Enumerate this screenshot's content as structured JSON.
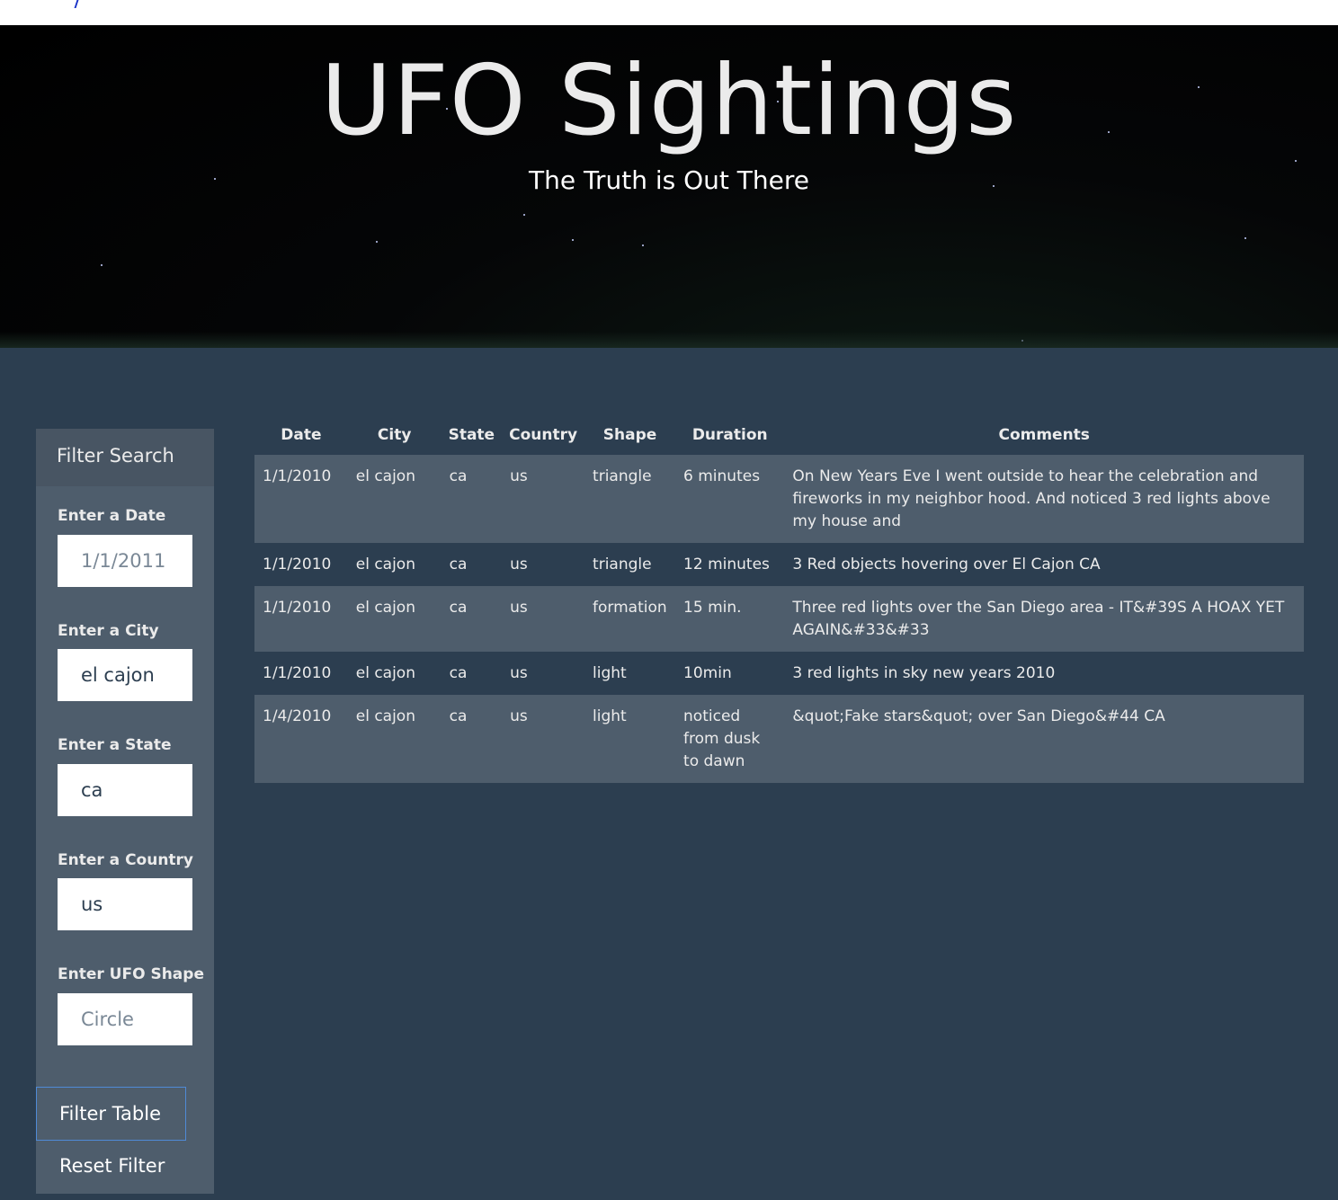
{
  "header": {
    "title": "UFO Sightings",
    "subtitle": "The Truth is Out There"
  },
  "sidebar": {
    "heading": "Filter Search",
    "fields": [
      {
        "label": "Enter a Date",
        "value": "",
        "placeholder": "1/1/2011"
      },
      {
        "label": "Enter a City",
        "value": "el cajon",
        "placeholder": ""
      },
      {
        "label": "Enter a State",
        "value": "ca",
        "placeholder": ""
      },
      {
        "label": "Enter a Country",
        "value": "us",
        "placeholder": ""
      },
      {
        "label": "Enter UFO Shape",
        "value": "",
        "placeholder": "Circle"
      }
    ],
    "filter_button": "Filter Table",
    "reset_button": "Reset Filter"
  },
  "table": {
    "columns": [
      "Date",
      "City",
      "State",
      "Country",
      "Shape",
      "Duration",
      "Comments"
    ],
    "rows": [
      [
        "1/1/2010",
        "el cajon",
        "ca",
        "us",
        "triangle",
        "6 minutes",
        "On New Years Eve I went outside to hear the celebration and fireworks in my neighbor hood. And noticed 3 red lights above my house and"
      ],
      [
        "1/1/2010",
        "el cajon",
        "ca",
        "us",
        "triangle",
        "12 minutes",
        "3 Red objects hovering over El Cajon CA"
      ],
      [
        "1/1/2010",
        "el cajon",
        "ca",
        "us",
        "formation",
        "15 min.",
        "Three red lights over the San Diego area - IT&#39S A HOAX YET AGAIN&#33&#33"
      ],
      [
        "1/1/2010",
        "el cajon",
        "ca",
        "us",
        "light",
        "10min",
        "3 red lights in sky new years 2010"
      ],
      [
        "1/4/2010",
        "el cajon",
        "ca",
        "us",
        "light",
        "noticed from dusk to dawn",
        "&quot;Fake stars&quot; over San Diego&#44 CA"
      ]
    ]
  },
  "colors": {
    "page_background": "#2c3e50",
    "panel": "#4e5d6c",
    "text": "#ebebeb",
    "button_border": "#4f8ad6"
  }
}
